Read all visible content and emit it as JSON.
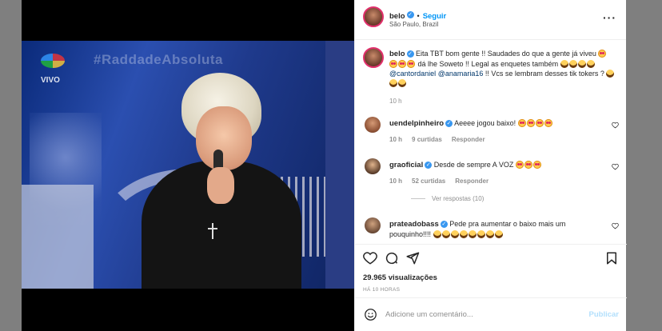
{
  "post": {
    "username": "belo",
    "follow_label": "Seguir",
    "location": "São Paulo, Brazil",
    "media": {
      "watermark": "#RaddadeAbsoluta",
      "channel_badge": "VIVO"
    }
  },
  "caption": {
    "username": "belo",
    "text_1": "Eita TBT bom gente !! Saudades do que a gente já viveu",
    "text_2": "dá lhe Soweto !! Legal as enquetes também",
    "mention_1": "@cantordaniel",
    "mention_2": "@anamaria16",
    "text_3": "!! Vcs se lembram desses tik tokers ?",
    "time": "10 h"
  },
  "comments": [
    {
      "username": "uendelpinheiro",
      "text": "Aeeee jogou baixo!",
      "time": "10 h",
      "likes": "9 curtidas",
      "reply": "Responder"
    },
    {
      "username": "graoficial",
      "text": "Desde de sempre A VOZ",
      "time": "10 h",
      "likes": "52 curtidas",
      "reply": "Responder",
      "view_replies": "Ver respostas (10)"
    },
    {
      "username": "prateadobass",
      "text": "Pede pra aumentar o baixo mais um pouquinho!!!!"
    }
  ],
  "stats": {
    "views": "29.965 visualizações",
    "time_ago": "HÁ 10 HORAS"
  },
  "comment_box": {
    "placeholder": "Adicione um comentário...",
    "publish_label": "Publicar"
  },
  "colors": {
    "accent": "#0095f6",
    "verified": "#3897f0",
    "overlay": "#7f7f7f"
  }
}
